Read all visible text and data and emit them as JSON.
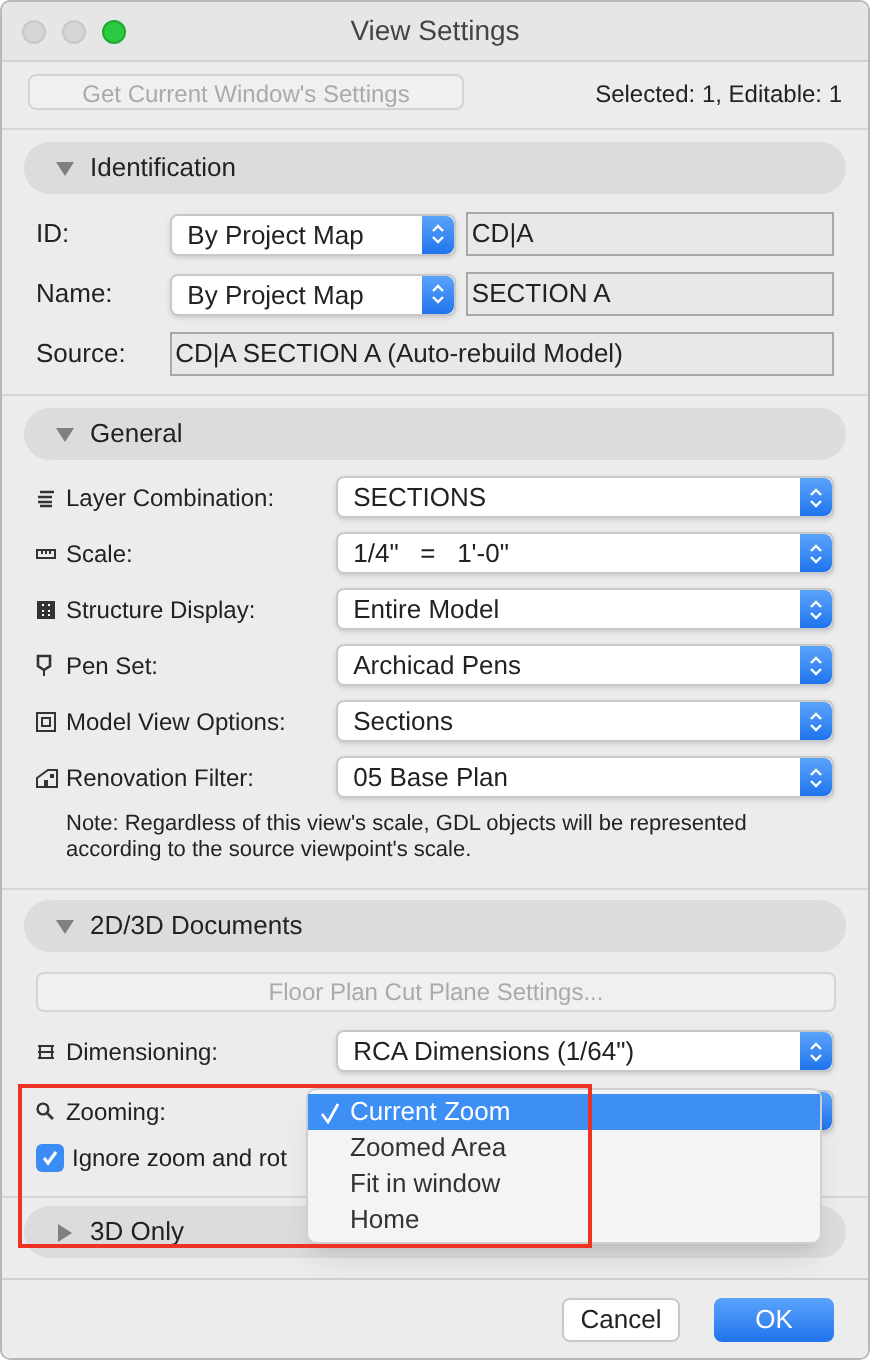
{
  "window": {
    "title": "View Settings"
  },
  "top": {
    "settings_button": {
      "label": "Get Current Window's Settings",
      "disabled": true
    },
    "selection_info": "Selected: 1, Editable: 1"
  },
  "identification": {
    "title": "Identification",
    "expanded": true,
    "rows": [
      {
        "label": "ID:",
        "mode": "By Project Map",
        "value": "CD|A"
      },
      {
        "label": "Name:",
        "mode": "By Project Map",
        "value": "SECTION A"
      }
    ],
    "source": {
      "label": "Source:",
      "value": "CD|A SECTION A (Auto-rebuild Model)"
    }
  },
  "general": {
    "title": "General",
    "expanded": true,
    "rows": [
      {
        "label": "Layer Combination:",
        "value": "SECTIONS"
      },
      {
        "label": "Scale:",
        "value": "1/4\"   =   1'-0\""
      },
      {
        "label": "Structure Display:",
        "value": "Entire Model"
      },
      {
        "label": "Pen Set:",
        "value": "Archicad Pens"
      },
      {
        "label": "Model View Options:",
        "value": "Sections"
      },
      {
        "label": "Renovation Filter:",
        "value": "05 Base Plan"
      }
    ],
    "note": "Note: Regardless of this view's scale, GDL objects will be represented according to the source viewpoint's scale."
  },
  "documents": {
    "title": "2D/3D Documents",
    "expanded": true,
    "cut_plane_button": {
      "label": "Floor Plan Cut Plane Settings...",
      "disabled": true
    },
    "dimensioning": {
      "label": "Dimensioning:",
      "value": "RCA Dimensions (1/64\")"
    },
    "zooming": {
      "label": "Zooming:",
      "options": [
        {
          "label": "Current Zoom",
          "selected": true
        },
        {
          "label": "Zoomed Area",
          "selected": false
        },
        {
          "label": "Fit in window",
          "selected": false
        },
        {
          "label": "Home",
          "selected": false
        }
      ]
    },
    "ignore_checkbox": {
      "label": "Ignore zoom and rot",
      "checked": true
    }
  },
  "three_d": {
    "title": "3D Only",
    "expanded": false
  },
  "buttons": [
    {
      "label": "Cancel",
      "kind": "secondary"
    },
    {
      "label": "OK",
      "kind": "primary"
    }
  ]
}
